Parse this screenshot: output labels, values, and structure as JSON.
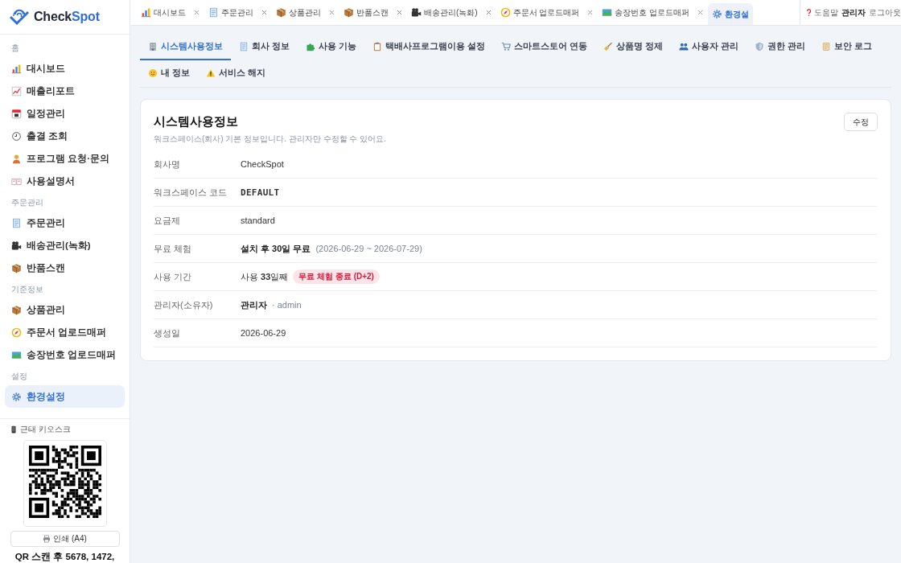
{
  "brand": {
    "lead": "Check",
    "accent": "Spot"
  },
  "sidebar": {
    "sections": [
      {
        "title": "홈",
        "items": [
          {
            "label": "대시보드",
            "selected": false
          },
          {
            "label": "매출리포트",
            "selected": false
          },
          {
            "label": "일정관리",
            "selected": false
          },
          {
            "label": "출결 조회",
            "selected": false
          },
          {
            "label": "프로그램 요청·문의",
            "selected": false
          },
          {
            "label": "사용설명서",
            "selected": false
          }
        ]
      },
      {
        "title": "주문관리",
        "items": [
          {
            "label": "주문관리",
            "selected": false
          },
          {
            "label": "배송관리(녹화)",
            "selected": false
          },
          {
            "label": "반품스캔",
            "selected": false
          }
        ]
      },
      {
        "title": "기준정보",
        "items": [
          {
            "label": "상품관리",
            "selected": false
          },
          {
            "label": "주문서 업로드매퍼",
            "selected": false
          },
          {
            "label": "송장번호 업로드매퍼",
            "selected": false
          }
        ]
      },
      {
        "title": "설정",
        "items": [
          {
            "label": "환경설정",
            "selected": true
          }
        ]
      }
    ],
    "kiosk": {
      "title": "근태 키오스크",
      "print_button": "인쇄 (A4)",
      "note": "QR 스캔 후 5678, 1472,"
    }
  },
  "tabs": [
    {
      "label": "대시보드",
      "selected": false
    },
    {
      "label": "주문관리",
      "selected": false
    },
    {
      "label": "상품관리",
      "selected": false
    },
    {
      "label": "반품스캔",
      "selected": false
    },
    {
      "label": "배송관리(녹화)",
      "selected": false
    },
    {
      "label": "주문서 업로드매퍼",
      "selected": false
    },
    {
      "label": "송장번호 업로드매퍼",
      "selected": false
    },
    {
      "label": "환경설",
      "selected": true
    }
  ],
  "header_links": {
    "help": "도움말",
    "user": "관리자",
    "logout": "로그아웃"
  },
  "sub_tabs": [
    {
      "label": "시스템사용정보",
      "selected": true
    },
    {
      "label": "회사 정보",
      "selected": false
    },
    {
      "label": "사용 기능",
      "selected": false
    },
    {
      "label": "택배사프로그램이용 설정",
      "selected": false
    },
    {
      "label": "스마트스토어 연동",
      "selected": false
    },
    {
      "label": "상품명 정제",
      "selected": false
    },
    {
      "label": "사용자 관리",
      "selected": false
    },
    {
      "label": "권한 관리",
      "selected": false
    },
    {
      "label": "보안 로그",
      "selected": false
    },
    {
      "label": "내 정보",
      "selected": false
    },
    {
      "label": "서비스 해지",
      "selected": false
    }
  ],
  "card": {
    "title": "시스템사용정보",
    "description": "워크스페이스(회사) 기본 정보입니다. 관리자만 수정할 수 있어요.",
    "edit_button": "수정",
    "rows": [
      {
        "label": "회사명",
        "value": "CheckSpot",
        "kind": "plain"
      },
      {
        "label": "워크스페이스 코드",
        "value": "DEFAULT",
        "kind": "code"
      },
      {
        "label": "요금제",
        "value": "standard",
        "kind": "plain"
      },
      {
        "label": "무료 체험",
        "value": "설치 후 30일 무료",
        "kind": "strong",
        "note": "(2026-06-29 ~ 2026-07-29)"
      },
      {
        "label": "사용 기간",
        "value": "사용 **33**일째",
        "kind": "plain",
        "badge": "무료 체험 종료 (D+2)"
      },
      {
        "label": "관리자(소유자)",
        "value": "관리자",
        "kind": "strong",
        "note": "· admin"
      },
      {
        "label": "생성일",
        "value": "2026-06-29",
        "kind": "plain"
      }
    ]
  }
}
